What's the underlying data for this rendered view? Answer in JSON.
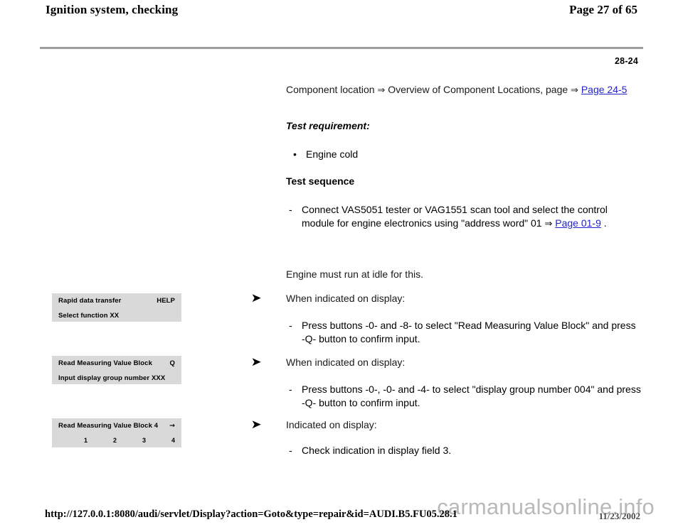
{
  "header": {
    "title": "Ignition system, checking",
    "page_label": "Page 27 of 65"
  },
  "section_code": "28-24",
  "content": {
    "component_location": {
      "text_part1": "Component location",
      "arrow": "⇒",
      "text_part2": "Overview of Component Locations, page",
      "arrow2": "⇒",
      "link": "Page 24-5"
    },
    "test_requirement_heading": "Test requirement:",
    "test_requirement_bullets": [
      {
        "bullet": "•",
        "text": "Engine cold"
      }
    ],
    "test_sequence_heading": "Test sequence",
    "step_connect": {
      "dash": "-",
      "text_before": "Connect VAS5051 tester or VAG1551 scan tool and select the control module for engine electronics using \"address word\" 01",
      "arrow": "⇒",
      "link": "Page 01-9",
      "text_after": "."
    },
    "idle_note": "Engine must run at idle for this.",
    "steps": [
      {
        "marker": "➤",
        "intro": "When indicated on display:",
        "dash": "-",
        "instruction": "Press buttons -0- and -8- to select \"Read Measuring Value Block\" and press -Q- button to confirm input."
      },
      {
        "marker": "➤",
        "intro": "When indicated on display:",
        "dash": "-",
        "instruction": "Press buttons -0-, -0- and -4- to select \"display group number 004\" and press -Q- button to confirm input."
      },
      {
        "marker": "➤",
        "intro": "Indicated on display:",
        "dash": "-",
        "instruction": "Check indication in display field 3."
      }
    ]
  },
  "displays": [
    {
      "line1_left": "Rapid data transfer",
      "line1_right": "HELP",
      "line2_left": "Select function XX",
      "line2_right": ""
    },
    {
      "line1_left": "Read Measuring Value Block",
      "line1_right": "Q",
      "line2_left": "Input display group number XXX",
      "line2_right": ""
    },
    {
      "line1_left": "Read Measuring Value Block 4",
      "line1_right": "→",
      "fields": [
        "1",
        "2",
        "3",
        "4"
      ]
    }
  ],
  "footer": {
    "url": "http://127.0.0.1:8080/audi/servlet/Display?action=Goto&type=repair&id=AUDI.B5.FU05.28.1",
    "date": "11/23/2002",
    "watermark": "carmanualsonline.info"
  }
}
